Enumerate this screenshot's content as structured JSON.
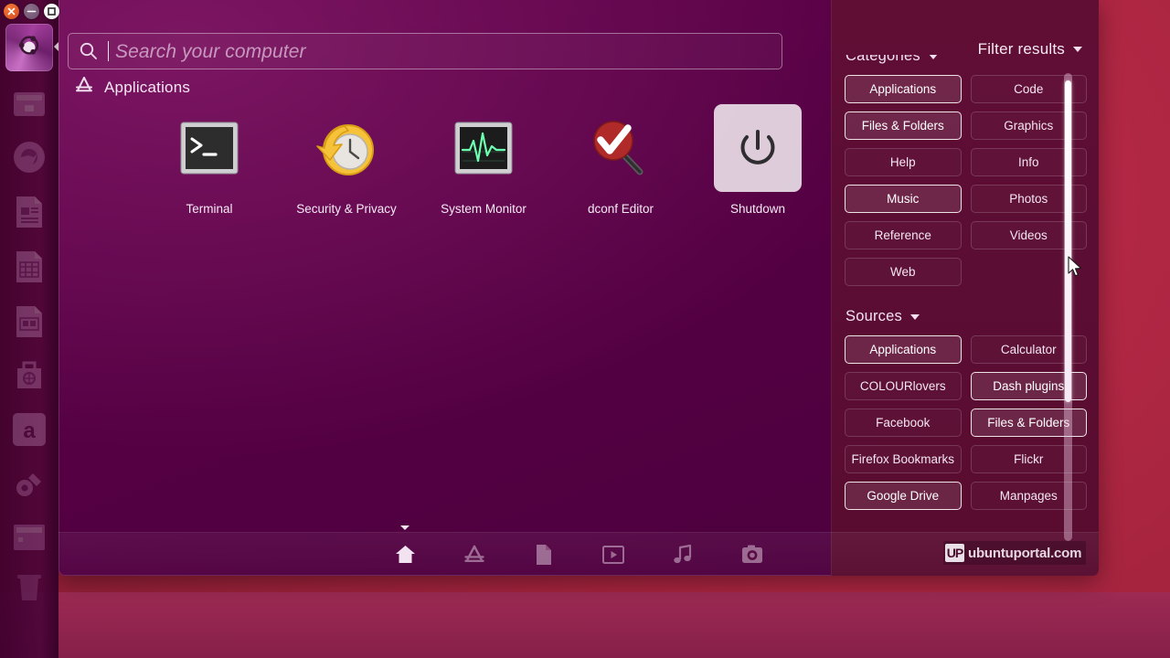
{
  "window_controls": [
    {
      "name": "close",
      "glyph": "x",
      "color": "#e0521f"
    },
    {
      "name": "minimize",
      "glyph": "-",
      "color": "#7b5c7a"
    },
    {
      "name": "maximize",
      "glyph": "[]",
      "color": "#ffffff"
    }
  ],
  "launcher": {
    "logo_name": "ubuntu-logo",
    "items": [
      {
        "name": "files-nautilus"
      },
      {
        "name": "firefox"
      },
      {
        "name": "libreoffice-writer"
      },
      {
        "name": "libreoffice-calc"
      },
      {
        "name": "libreoffice-impress"
      },
      {
        "name": "ubuntu-software-center"
      },
      {
        "name": "amazon",
        "label": "a"
      },
      {
        "name": "system-settings"
      },
      {
        "name": "workspace-switcher"
      },
      {
        "name": "trash"
      }
    ]
  },
  "search": {
    "placeholder": "Search your computer",
    "value": "",
    "icon": "search-icon"
  },
  "filter_results": {
    "label": "Filter results",
    "icon": "chevron-down-icon"
  },
  "results": {
    "section_title": "Applications",
    "section_icon": "applications-lens-icon",
    "apps": [
      {
        "label": "Terminal",
        "icon": "terminal-icon",
        "selected": false
      },
      {
        "label": "Security & Privacy",
        "icon": "security-privacy-icon",
        "selected": false
      },
      {
        "label": "System Monitor",
        "icon": "system-monitor-icon",
        "selected": false
      },
      {
        "label": "dconf Editor",
        "icon": "dconf-editor-icon",
        "selected": false
      },
      {
        "label": "Shutdown",
        "icon": "power-icon",
        "selected": true
      }
    ]
  },
  "filters": {
    "categories": {
      "title": "Categories",
      "icon": "chevron-down-icon",
      "items": [
        {
          "label": "Applications",
          "active": true
        },
        {
          "label": "Code",
          "active": false
        },
        {
          "label": "Files & Folders",
          "active": true
        },
        {
          "label": "Graphics",
          "active": false
        },
        {
          "label": "Help",
          "active": false
        },
        {
          "label": "Info",
          "active": false
        },
        {
          "label": "Music",
          "active": true
        },
        {
          "label": "Photos",
          "active": false
        },
        {
          "label": "Reference",
          "active": false
        },
        {
          "label": "Videos",
          "active": false
        },
        {
          "label": "Web",
          "active": false
        }
      ]
    },
    "sources": {
      "title": "Sources",
      "icon": "chevron-down-icon",
      "items": [
        {
          "label": "Applications",
          "active": true
        },
        {
          "label": "Calculator",
          "active": false
        },
        {
          "label": "COLOURlovers",
          "active": false
        },
        {
          "label": "Dash plugins",
          "active": true
        },
        {
          "label": "Facebook",
          "active": false
        },
        {
          "label": "Files & Folders",
          "active": true
        },
        {
          "label": "Firefox Bookmarks",
          "active": false
        },
        {
          "label": "Flickr",
          "active": false
        },
        {
          "label": "Google Drive",
          "active": true
        },
        {
          "label": "Manpages",
          "active": false
        }
      ]
    }
  },
  "lens_bar": {
    "lenses": [
      {
        "name": "home-lens",
        "active": true
      },
      {
        "name": "applications-lens",
        "active": false
      },
      {
        "name": "files-lens",
        "active": false
      },
      {
        "name": "video-lens",
        "active": false
      },
      {
        "name": "music-lens",
        "active": false
      },
      {
        "name": "photos-lens",
        "active": false
      }
    ]
  },
  "watermark": {
    "logo": "UP",
    "text": "ubuntuportal.com"
  },
  "colors": {
    "dash_bg": "#570043",
    "filter_bg": "#5e0f33",
    "desktop": "#a8243f",
    "accent": "#f4e6f2"
  }
}
